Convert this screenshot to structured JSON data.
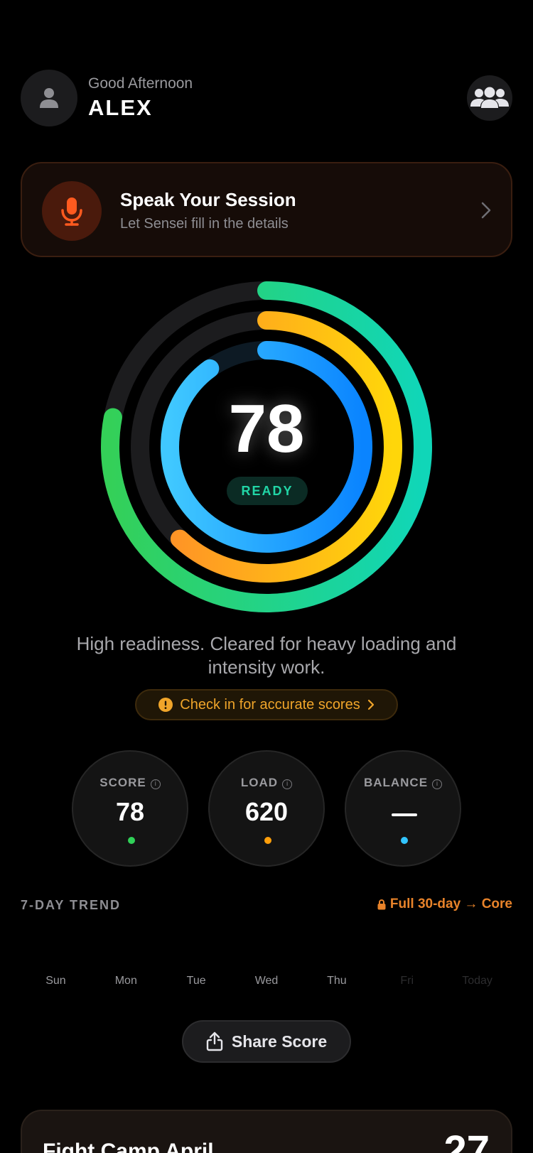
{
  "header": {
    "greeting": "Good Afternoon",
    "username": "ALEX",
    "avatar_icon": "person-icon",
    "group_icon": "group-icon"
  },
  "speak_card": {
    "title": "Speak Your Session",
    "subtitle": "Let Sensei fill in the details",
    "icon": "microphone-icon",
    "accent": "#ff5a1f"
  },
  "readiness": {
    "score": "78",
    "status": "READY",
    "description": "High readiness. Cleared for heavy loading and intensity work.",
    "rings": [
      {
        "name": "outer",
        "progress": 0.78,
        "colors": [
          "#34d058",
          "#10d6b8"
        ]
      },
      {
        "name": "middle",
        "progress": 0.62,
        "colors": [
          "#ff8a2a",
          "#ffd60a"
        ]
      },
      {
        "name": "inner",
        "progress": 0.9,
        "colors": [
          "#40c8ff",
          "#0a84ff"
        ]
      }
    ]
  },
  "checkin": {
    "label": "Check in for accurate scores",
    "color": "#f0a52a"
  },
  "stats": [
    {
      "label": "SCORE",
      "value": "78",
      "dot_color": "#30d158"
    },
    {
      "label": "LOAD",
      "value": "620",
      "dot_color": "#ff9f0a"
    },
    {
      "label": "BALANCE",
      "value": "",
      "dot_color": "#32c5ff"
    }
  ],
  "trend": {
    "title": "7-DAY TREND",
    "upsell": "Full 30-day → Core",
    "days": [
      "Sun",
      "Mon",
      "Tue",
      "Wed",
      "Thu",
      "Fri",
      "Today"
    ]
  },
  "share": {
    "label": "Share Score",
    "icon": "share-icon"
  },
  "camp": {
    "title": "Fight Camp April",
    "days_value": "27"
  }
}
